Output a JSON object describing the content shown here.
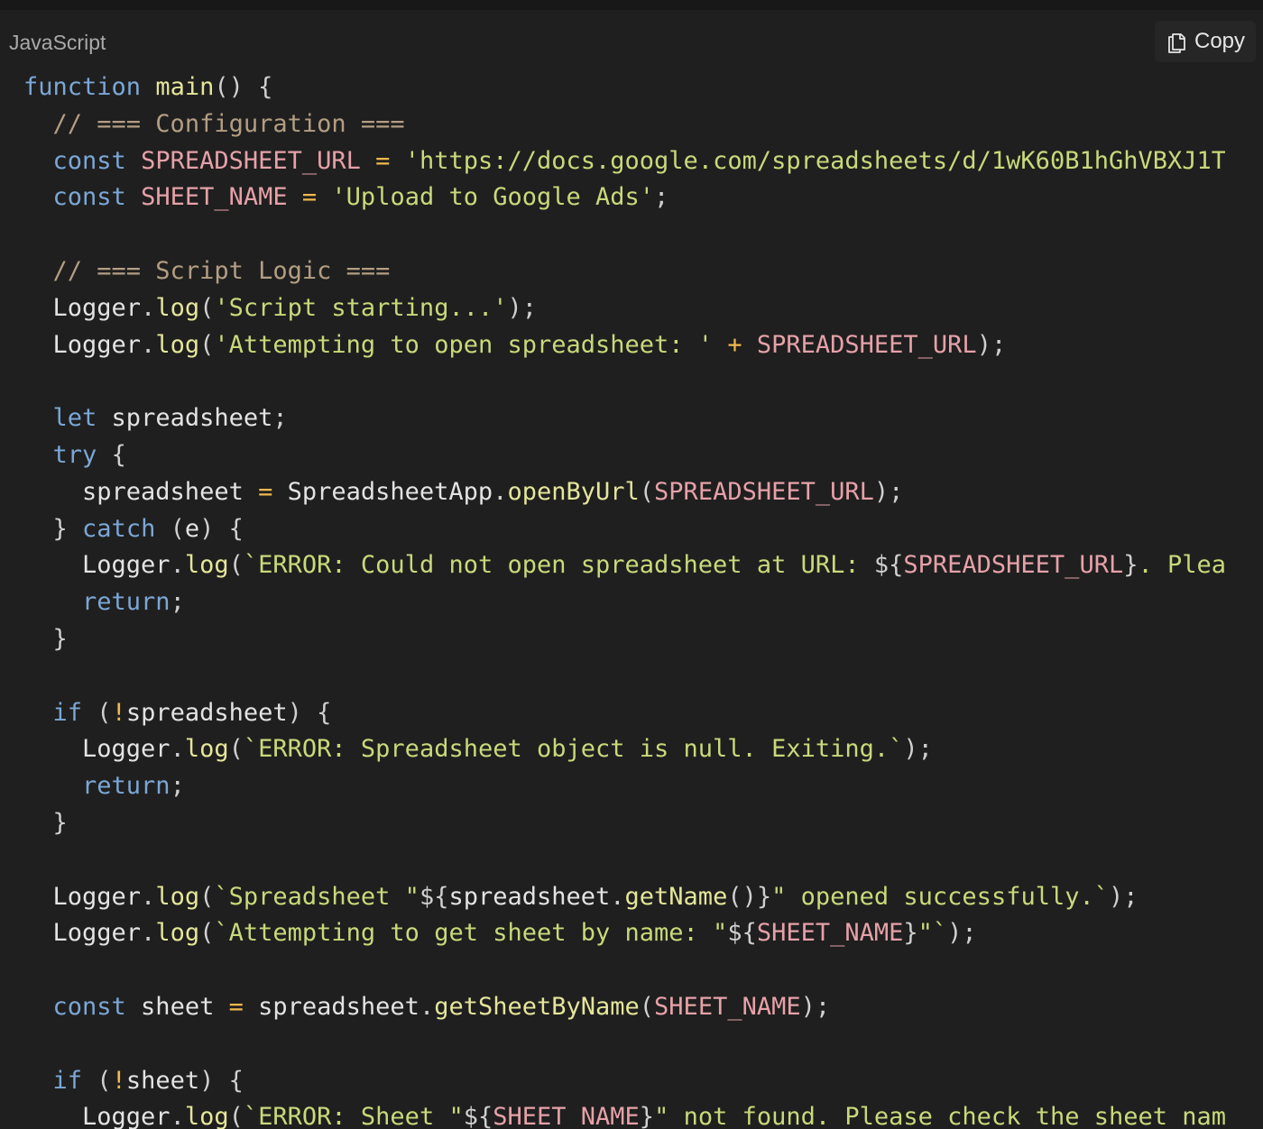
{
  "header": {
    "language": "JavaScript",
    "copy_label": "Copy",
    "copy_icon": "copy-icon"
  },
  "colors": {
    "background": "#1f1f1f",
    "keyword": "#7ba7d6",
    "function": "#e5e59b",
    "string": "#c8d97a",
    "constant": "#e6a1a8",
    "comment": "#b39e83",
    "operator": "#f0b94d"
  },
  "code": {
    "lines": [
      [
        [
          "kw",
          "function"
        ],
        [
          "plain",
          " "
        ],
        [
          "fn",
          "main"
        ],
        [
          "punc",
          "() {"
        ]
      ],
      [
        [
          "plain",
          "  "
        ],
        [
          "comment",
          "// === Configuration ==="
        ]
      ],
      [
        [
          "plain",
          "  "
        ],
        [
          "kw",
          "const"
        ],
        [
          "plain",
          " "
        ],
        [
          "const",
          "SPREADSHEET_URL"
        ],
        [
          "plain",
          " "
        ],
        [
          "op",
          "="
        ],
        [
          "plain",
          " "
        ],
        [
          "str",
          "'https://docs.google.com/spreadsheets/d/1wK60B1hGhVBXJ1T"
        ]
      ],
      [
        [
          "plain",
          "  "
        ],
        [
          "kw",
          "const"
        ],
        [
          "plain",
          " "
        ],
        [
          "const",
          "SHEET_NAME"
        ],
        [
          "plain",
          " "
        ],
        [
          "op",
          "="
        ],
        [
          "plain",
          " "
        ],
        [
          "str",
          "'Upload to Google Ads'"
        ],
        [
          "punc",
          ";"
        ]
      ],
      [],
      [
        [
          "plain",
          "  "
        ],
        [
          "comment",
          "// === Script Logic ==="
        ]
      ],
      [
        [
          "plain",
          "  Logger"
        ],
        [
          "punc",
          "."
        ],
        [
          "fn",
          "log"
        ],
        [
          "punc",
          "("
        ],
        [
          "str",
          "'Script starting...'"
        ],
        [
          "punc",
          ");"
        ]
      ],
      [
        [
          "plain",
          "  Logger"
        ],
        [
          "punc",
          "."
        ],
        [
          "fn",
          "log"
        ],
        [
          "punc",
          "("
        ],
        [
          "str",
          "'Attempting to open spreadsheet: '"
        ],
        [
          "plain",
          " "
        ],
        [
          "op",
          "+"
        ],
        [
          "plain",
          " "
        ],
        [
          "const",
          "SPREADSHEET_URL"
        ],
        [
          "punc",
          ");"
        ]
      ],
      [],
      [
        [
          "plain",
          "  "
        ],
        [
          "kw",
          "let"
        ],
        [
          "plain",
          " spreadsheet"
        ],
        [
          "punc",
          ";"
        ]
      ],
      [
        [
          "plain",
          "  "
        ],
        [
          "kw",
          "try"
        ],
        [
          "plain",
          " "
        ],
        [
          "punc",
          "{"
        ]
      ],
      [
        [
          "plain",
          "    spreadsheet "
        ],
        [
          "op",
          "="
        ],
        [
          "plain",
          " SpreadsheetApp"
        ],
        [
          "punc",
          "."
        ],
        [
          "fn",
          "openByUrl"
        ],
        [
          "punc",
          "("
        ],
        [
          "const",
          "SPREADSHEET_URL"
        ],
        [
          "punc",
          ");"
        ]
      ],
      [
        [
          "plain",
          "  "
        ],
        [
          "punc",
          "}"
        ],
        [
          "plain",
          " "
        ],
        [
          "kw",
          "catch"
        ],
        [
          "plain",
          " "
        ],
        [
          "punc",
          "("
        ],
        [
          "plain",
          "e"
        ],
        [
          "punc",
          ")"
        ],
        [
          "plain",
          " "
        ],
        [
          "punc",
          "{"
        ]
      ],
      [
        [
          "plain",
          "    Logger"
        ],
        [
          "punc",
          "."
        ],
        [
          "fn",
          "log"
        ],
        [
          "punc",
          "("
        ],
        [
          "str",
          "`ERROR: Could not open spreadsheet at URL: "
        ],
        [
          "punc",
          "${"
        ],
        [
          "const",
          "SPREADSHEET_URL"
        ],
        [
          "punc",
          "}"
        ],
        [
          "str",
          ". Please"
        ]
      ],
      [
        [
          "plain",
          "    "
        ],
        [
          "kw",
          "return"
        ],
        [
          "punc",
          ";"
        ]
      ],
      [
        [
          "plain",
          "  "
        ],
        [
          "punc",
          "}"
        ]
      ],
      [],
      [
        [
          "plain",
          "  "
        ],
        [
          "kw",
          "if"
        ],
        [
          "plain",
          " "
        ],
        [
          "punc",
          "("
        ],
        [
          "op",
          "!"
        ],
        [
          "plain",
          "spreadsheet"
        ],
        [
          "punc",
          ")"
        ],
        [
          "plain",
          " "
        ],
        [
          "punc",
          "{"
        ]
      ],
      [
        [
          "plain",
          "    Logger"
        ],
        [
          "punc",
          "."
        ],
        [
          "fn",
          "log"
        ],
        [
          "punc",
          "("
        ],
        [
          "str",
          "`ERROR: Spreadsheet object is null. Exiting.`"
        ],
        [
          "punc",
          ");"
        ]
      ],
      [
        [
          "plain",
          "    "
        ],
        [
          "kw",
          "return"
        ],
        [
          "punc",
          ";"
        ]
      ],
      [
        [
          "plain",
          "  "
        ],
        [
          "punc",
          "}"
        ]
      ],
      [],
      [
        [
          "plain",
          "  Logger"
        ],
        [
          "punc",
          "."
        ],
        [
          "fn",
          "log"
        ],
        [
          "punc",
          "("
        ],
        [
          "str",
          "`Spreadsheet \""
        ],
        [
          "punc",
          "${"
        ],
        [
          "plain",
          "spreadsheet"
        ],
        [
          "punc",
          "."
        ],
        [
          "fn",
          "getName"
        ],
        [
          "punc",
          "()}"
        ],
        [
          "str",
          "\" opened successfully.`"
        ],
        [
          "punc",
          ");"
        ]
      ],
      [
        [
          "plain",
          "  Logger"
        ],
        [
          "punc",
          "."
        ],
        [
          "fn",
          "log"
        ],
        [
          "punc",
          "("
        ],
        [
          "str",
          "`Attempting to get sheet by name: \""
        ],
        [
          "punc",
          "${"
        ],
        [
          "const",
          "SHEET_NAME"
        ],
        [
          "punc",
          "}"
        ],
        [
          "str",
          "\"`"
        ],
        [
          "punc",
          ");"
        ]
      ],
      [],
      [
        [
          "plain",
          "  "
        ],
        [
          "kw",
          "const"
        ],
        [
          "plain",
          " sheet "
        ],
        [
          "op",
          "="
        ],
        [
          "plain",
          " spreadsheet"
        ],
        [
          "punc",
          "."
        ],
        [
          "fn",
          "getSheetByName"
        ],
        [
          "punc",
          "("
        ],
        [
          "const",
          "SHEET_NAME"
        ],
        [
          "punc",
          ");"
        ]
      ],
      [],
      [
        [
          "plain",
          "  "
        ],
        [
          "kw",
          "if"
        ],
        [
          "plain",
          " "
        ],
        [
          "punc",
          "("
        ],
        [
          "op",
          "!"
        ],
        [
          "plain",
          "sheet"
        ],
        [
          "punc",
          ")"
        ],
        [
          "plain",
          " "
        ],
        [
          "punc",
          "{"
        ]
      ],
      [
        [
          "plain",
          "    Logger"
        ],
        [
          "punc",
          "."
        ],
        [
          "fn",
          "log"
        ],
        [
          "punc",
          "("
        ],
        [
          "str",
          "`ERROR: Sheet \""
        ],
        [
          "punc",
          "${"
        ],
        [
          "const",
          "SHEET_NAME"
        ],
        [
          "punc",
          "}"
        ],
        [
          "str",
          "\" not found. Please check the sheet name"
        ]
      ]
    ]
  }
}
